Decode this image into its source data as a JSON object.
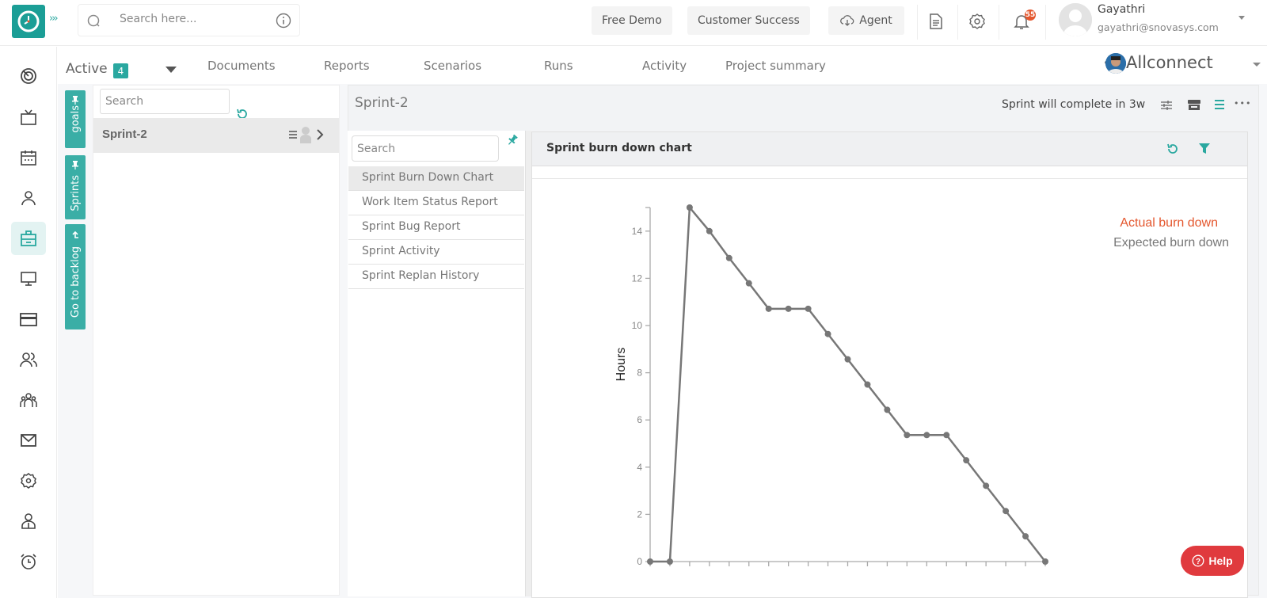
{
  "header": {
    "search_placeholder": "Search here...",
    "buttons": {
      "free_demo": "Free Demo",
      "customer_success": "Customer Success",
      "agent": "Agent"
    },
    "notification_count": "55",
    "user": {
      "name": "Gayathri",
      "email": "gayathri@snovasys.com"
    }
  },
  "left_nav": {
    "items": [
      "dashboard",
      "tv",
      "calendar",
      "user",
      "projects",
      "desktop",
      "billing",
      "team",
      "groups",
      "mail",
      "settings",
      "profile",
      "alarm"
    ],
    "active": "projects"
  },
  "subnav": {
    "active_label": "Active",
    "active_count": "4",
    "tabs": [
      "Documents",
      "Reports",
      "Scenarios",
      "Runs",
      "Activity",
      "Project summary"
    ],
    "project_name": "Allconnect"
  },
  "vertical_tabs": [
    "goals",
    "Sprints",
    "Go to backlog"
  ],
  "sprint_panel": {
    "search_placeholder": "Search",
    "sprints": [
      {
        "name": "Sprint-2"
      }
    ]
  },
  "right_panel": {
    "title": "Sprint-2",
    "status": "Sprint will complete in 3w"
  },
  "report_list": {
    "search_placeholder": "Search",
    "items": [
      "Sprint Burn Down Chart",
      "Work Item Status Report",
      "Sprint Bug Report",
      "Sprint Activity",
      "Sprint Replan History"
    ],
    "selected": 0
  },
  "chart_panel": {
    "title": "Sprint burn down chart"
  },
  "help_label": "Help",
  "colors": {
    "accent": "#2aa8a0",
    "actual_line": "#e4572e",
    "help": "#e03a3e"
  },
  "chart_data": {
    "type": "line",
    "title": "Sprint burn down chart",
    "xlabel": "",
    "ylabel": "Hours",
    "ylim": [
      0,
      15
    ],
    "yticks": [
      0,
      2,
      4,
      6,
      8,
      10,
      12,
      14
    ],
    "legend": [
      "Actual burn down",
      "Expected burn down"
    ],
    "legend_position": "top-right",
    "series": [
      {
        "name": "Expected burn down",
        "values": [
          0,
          0,
          15,
          14,
          12.86,
          11.79,
          10.71,
          10.71,
          10.71,
          9.64,
          8.57,
          7.5,
          6.43,
          5.36,
          5.36,
          5.36,
          4.29,
          3.21,
          2.14,
          1.07,
          0
        ]
      }
    ],
    "x_tick_count": 21
  }
}
